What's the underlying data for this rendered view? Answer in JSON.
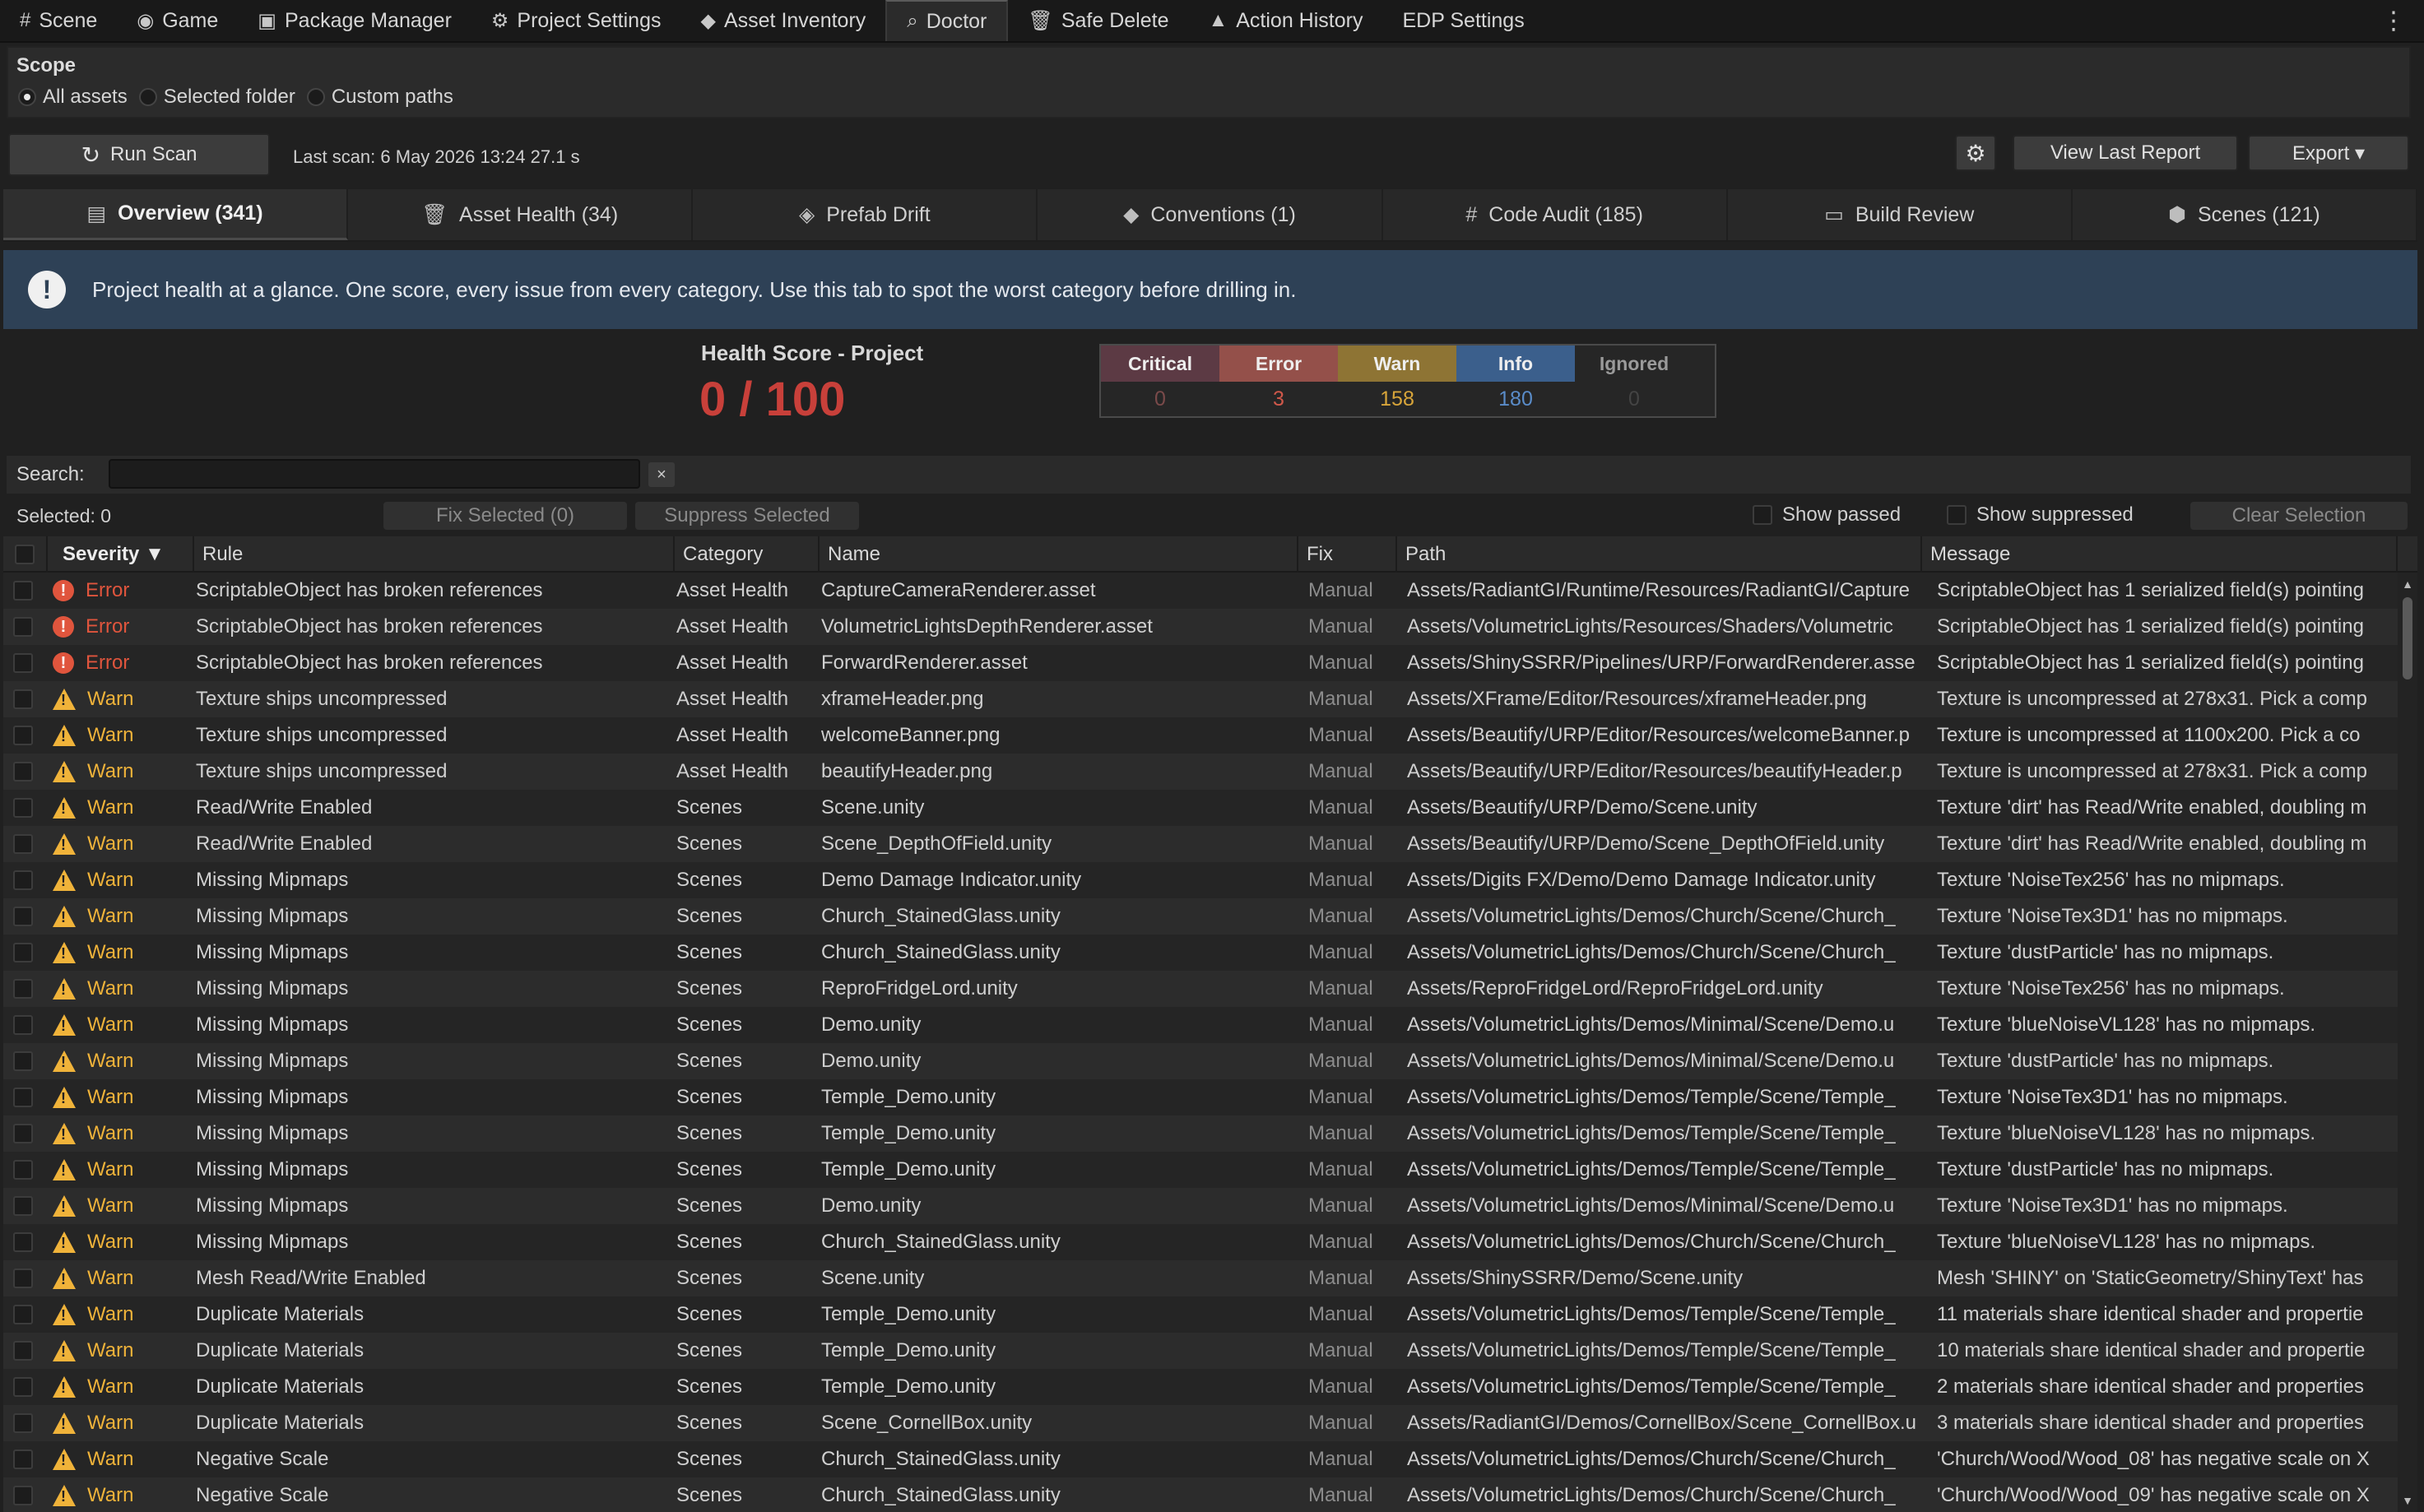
{
  "top_tabs": [
    {
      "icon": "#",
      "icon_name": "grid-icon",
      "label": "Scene"
    },
    {
      "icon": "◉",
      "icon_name": "gamepad-icon",
      "label": "Game"
    },
    {
      "icon": "▣",
      "icon_name": "package-icon",
      "label": "Package Manager"
    },
    {
      "icon": "⚙",
      "icon_name": "gear-icon",
      "label": "Project Settings"
    },
    {
      "icon": "◆",
      "icon_name": "tag-icon",
      "label": "Asset Inventory"
    },
    {
      "icon": "⌕",
      "icon_name": "search-icon",
      "label": "Doctor"
    },
    {
      "icon": "🗑",
      "icon_name": "trash-icon",
      "label": "Safe Delete"
    },
    {
      "icon": "▲",
      "icon_name": "history-icon",
      "label": "Action History"
    },
    {
      "icon": "",
      "icon_name": "",
      "label": "EDP Settings"
    }
  ],
  "active_top_tab": 5,
  "scope": {
    "label": "Scope",
    "options": [
      "All assets",
      "Selected folder",
      "Custom paths"
    ],
    "selected": 0
  },
  "scan": {
    "run_label": "Run Scan",
    "last_scan": "Last scan: 6 May 2026 13:24   27.1 s",
    "view_report_label": "View Last Report",
    "export_label": "Export ▾"
  },
  "tabs": [
    {
      "icon": "▤",
      "icon_name": "overview-icon",
      "label": "Overview (341)"
    },
    {
      "icon": "🗑",
      "icon_name": "trash-icon",
      "label": "Asset Health (34)"
    },
    {
      "icon": "◈",
      "icon_name": "cube-icon",
      "label": "Prefab Drift"
    },
    {
      "icon": "◆",
      "icon_name": "tag-icon",
      "label": "Conventions (1)"
    },
    {
      "icon": "#",
      "icon_name": "code-icon",
      "label": "Code Audit (185)"
    },
    {
      "icon": "▭",
      "icon_name": "monitor-icon",
      "label": "Build Review"
    },
    {
      "icon": "⬢",
      "icon_name": "unity-icon",
      "label": "Scenes (121)"
    }
  ],
  "active_tab": 0,
  "banner": {
    "text": "Project health at a glance. One score, every issue from every category. Use this tab to spot the worst category before drilling in."
  },
  "health": {
    "title": "Health Score - Project",
    "score": "0 / 100"
  },
  "severity_counts": [
    {
      "label": "Critical",
      "value": "0",
      "bg": "#5c3a44",
      "color": "#7a4a4a"
    },
    {
      "label": "Error",
      "value": "3",
      "bg": "#94504a",
      "color": "#d0584a"
    },
    {
      "label": "Warn",
      "value": "158",
      "bg": "#8e7434",
      "color": "#d8a53a"
    },
    {
      "label": "Info",
      "value": "180",
      "bg": "#3b5f8c",
      "color": "#5a8cc8"
    },
    {
      "label": "Ignored",
      "value": "0",
      "bg": "#262626",
      "color": "#444444"
    }
  ],
  "search": {
    "label": "Search:",
    "value": "",
    "clear": "×"
  },
  "actions": {
    "selected": "Selected: 0",
    "fix_selected": "Fix Selected (0)",
    "suppress_selected": "Suppress Selected",
    "show_passed": "Show passed",
    "show_suppressed": "Show suppressed",
    "clear_selection": "Clear Selection"
  },
  "columns": [
    "Severity ▼",
    "Rule",
    "Category",
    "Name",
    "Fix",
    "Path",
    "Message"
  ],
  "rows": [
    {
      "sev": "Error",
      "rule": "ScriptableObject has broken references",
      "cat": "Asset Health",
      "name": "CaptureCameraRenderer.asset",
      "fix": "Manual",
      "path": "Assets/RadiantGI/Runtime/Resources/RadiantGI/Capture",
      "msg": "ScriptableObject has 1 serialized field(s) pointing"
    },
    {
      "sev": "Error",
      "rule": "ScriptableObject has broken references",
      "cat": "Asset Health",
      "name": "VolumetricLightsDepthRenderer.asset",
      "fix": "Manual",
      "path": "Assets/VolumetricLights/Resources/Shaders/Volumetric",
      "msg": "ScriptableObject has 1 serialized field(s) pointing"
    },
    {
      "sev": "Error",
      "rule": "ScriptableObject has broken references",
      "cat": "Asset Health",
      "name": "ForwardRenderer.asset",
      "fix": "Manual",
      "path": "Assets/ShinySSRR/Pipelines/URP/ForwardRenderer.asse",
      "msg": "ScriptableObject has 1 serialized field(s) pointing"
    },
    {
      "sev": "Warn",
      "rule": "Texture ships uncompressed",
      "cat": "Asset Health",
      "name": "xframeHeader.png",
      "fix": "Manual",
      "path": "Assets/XFrame/Editor/Resources/xframeHeader.png",
      "msg": "Texture is uncompressed at 278x31. Pick a comp"
    },
    {
      "sev": "Warn",
      "rule": "Texture ships uncompressed",
      "cat": "Asset Health",
      "name": "welcomeBanner.png",
      "fix": "Manual",
      "path": "Assets/Beautify/URP/Editor/Resources/welcomeBanner.p",
      "msg": "Texture is uncompressed at 1100x200. Pick a co"
    },
    {
      "sev": "Warn",
      "rule": "Texture ships uncompressed",
      "cat": "Asset Health",
      "name": "beautifyHeader.png",
      "fix": "Manual",
      "path": "Assets/Beautify/URP/Editor/Resources/beautifyHeader.p",
      "msg": "Texture is uncompressed at 278x31. Pick a comp"
    },
    {
      "sev": "Warn",
      "rule": "Read/Write Enabled",
      "cat": "Scenes",
      "name": "Scene.unity",
      "fix": "Manual",
      "path": "Assets/Beautify/URP/Demo/Scene.unity",
      "msg": "Texture 'dirt' has Read/Write enabled, doubling m"
    },
    {
      "sev": "Warn",
      "rule": "Read/Write Enabled",
      "cat": "Scenes",
      "name": "Scene_DepthOfField.unity",
      "fix": "Manual",
      "path": "Assets/Beautify/URP/Demo/Scene_DepthOfField.unity",
      "msg": "Texture 'dirt' has Read/Write enabled, doubling m"
    },
    {
      "sev": "Warn",
      "rule": "Missing Mipmaps",
      "cat": "Scenes",
      "name": "Demo Damage Indicator.unity",
      "fix": "Manual",
      "path": "Assets/Digits FX/Demo/Demo Damage Indicator.unity",
      "msg": "Texture 'NoiseTex256' has no mipmaps."
    },
    {
      "sev": "Warn",
      "rule": "Missing Mipmaps",
      "cat": "Scenes",
      "name": "Church_StainedGlass.unity",
      "fix": "Manual",
      "path": "Assets/VolumetricLights/Demos/Church/Scene/Church_",
      "msg": "Texture 'NoiseTex3D1' has no mipmaps."
    },
    {
      "sev": "Warn",
      "rule": "Missing Mipmaps",
      "cat": "Scenes",
      "name": "Church_StainedGlass.unity",
      "fix": "Manual",
      "path": "Assets/VolumetricLights/Demos/Church/Scene/Church_",
      "msg": "Texture 'dustParticle' has no mipmaps."
    },
    {
      "sev": "Warn",
      "rule": "Missing Mipmaps",
      "cat": "Scenes",
      "name": "ReproFridgeLord.unity",
      "fix": "Manual",
      "path": "Assets/ReproFridgeLord/ReproFridgeLord.unity",
      "msg": "Texture 'NoiseTex256' has no mipmaps."
    },
    {
      "sev": "Warn",
      "rule": "Missing Mipmaps",
      "cat": "Scenes",
      "name": "Demo.unity",
      "fix": "Manual",
      "path": "Assets/VolumetricLights/Demos/Minimal/Scene/Demo.u",
      "msg": "Texture 'blueNoiseVL128' has no mipmaps."
    },
    {
      "sev": "Warn",
      "rule": "Missing Mipmaps",
      "cat": "Scenes",
      "name": "Demo.unity",
      "fix": "Manual",
      "path": "Assets/VolumetricLights/Demos/Minimal/Scene/Demo.u",
      "msg": "Texture 'dustParticle' has no mipmaps."
    },
    {
      "sev": "Warn",
      "rule": "Missing Mipmaps",
      "cat": "Scenes",
      "name": "Temple_Demo.unity",
      "fix": "Manual",
      "path": "Assets/VolumetricLights/Demos/Temple/Scene/Temple_",
      "msg": "Texture 'NoiseTex3D1' has no mipmaps."
    },
    {
      "sev": "Warn",
      "rule": "Missing Mipmaps",
      "cat": "Scenes",
      "name": "Temple_Demo.unity",
      "fix": "Manual",
      "path": "Assets/VolumetricLights/Demos/Temple/Scene/Temple_",
      "msg": "Texture 'blueNoiseVL128' has no mipmaps."
    },
    {
      "sev": "Warn",
      "rule": "Missing Mipmaps",
      "cat": "Scenes",
      "name": "Temple_Demo.unity",
      "fix": "Manual",
      "path": "Assets/VolumetricLights/Demos/Temple/Scene/Temple_",
      "msg": "Texture 'dustParticle' has no mipmaps."
    },
    {
      "sev": "Warn",
      "rule": "Missing Mipmaps",
      "cat": "Scenes",
      "name": "Demo.unity",
      "fix": "Manual",
      "path": "Assets/VolumetricLights/Demos/Minimal/Scene/Demo.u",
      "msg": "Texture 'NoiseTex3D1' has no mipmaps."
    },
    {
      "sev": "Warn",
      "rule": "Missing Mipmaps",
      "cat": "Scenes",
      "name": "Church_StainedGlass.unity",
      "fix": "Manual",
      "path": "Assets/VolumetricLights/Demos/Church/Scene/Church_",
      "msg": "Texture 'blueNoiseVL128' has no mipmaps."
    },
    {
      "sev": "Warn",
      "rule": "Mesh Read/Write Enabled",
      "cat": "Scenes",
      "name": "Scene.unity",
      "fix": "Manual",
      "path": "Assets/ShinySSRR/Demo/Scene.unity",
      "msg": "Mesh 'SHINY' on 'StaticGeometry/ShinyText' has"
    },
    {
      "sev": "Warn",
      "rule": "Duplicate Materials",
      "cat": "Scenes",
      "name": "Temple_Demo.unity",
      "fix": "Manual",
      "path": "Assets/VolumetricLights/Demos/Temple/Scene/Temple_",
      "msg": "11 materials share identical shader and propertie"
    },
    {
      "sev": "Warn",
      "rule": "Duplicate Materials",
      "cat": "Scenes",
      "name": "Temple_Demo.unity",
      "fix": "Manual",
      "path": "Assets/VolumetricLights/Demos/Temple/Scene/Temple_",
      "msg": "10 materials share identical shader and propertie"
    },
    {
      "sev": "Warn",
      "rule": "Duplicate Materials",
      "cat": "Scenes",
      "name": "Temple_Demo.unity",
      "fix": "Manual",
      "path": "Assets/VolumetricLights/Demos/Temple/Scene/Temple_",
      "msg": "2 materials share identical shader and properties"
    },
    {
      "sev": "Warn",
      "rule": "Duplicate Materials",
      "cat": "Scenes",
      "name": "Scene_CornellBox.unity",
      "fix": "Manual",
      "path": "Assets/RadiantGI/Demos/CornellBox/Scene_CornellBox.u",
      "msg": "3 materials share identical shader and properties"
    },
    {
      "sev": "Warn",
      "rule": "Negative Scale",
      "cat": "Scenes",
      "name": "Church_StainedGlass.unity",
      "fix": "Manual",
      "path": "Assets/VolumetricLights/Demos/Church/Scene/Church_",
      "msg": "'Church/Wood/Wood_08' has negative scale on X"
    },
    {
      "sev": "Warn",
      "rule": "Negative Scale",
      "cat": "Scenes",
      "name": "Church_StainedGlass.unity",
      "fix": "Manual",
      "path": "Assets/VolumetricLights/Demos/Church/Scene/Church_",
      "msg": "'Church/Wood/Wood_09' has negative scale on X"
    }
  ]
}
